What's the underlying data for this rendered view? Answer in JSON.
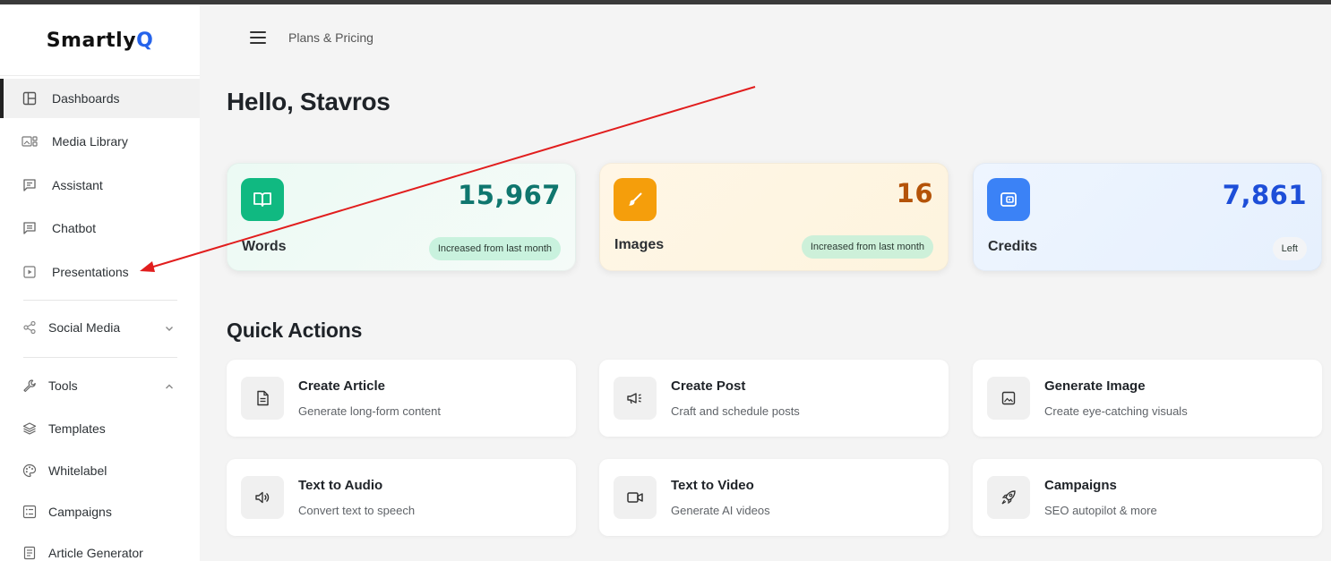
{
  "app": {
    "logo_prefix": "Smartly",
    "logo_suffix": "Q"
  },
  "header": {
    "breadcrumb": "Plans & Pricing"
  },
  "sidebar": {
    "items": [
      {
        "label": "Dashboards",
        "icon": "layout-icon"
      },
      {
        "label": "Media Library",
        "icon": "media-library-icon"
      },
      {
        "label": "Assistant",
        "icon": "chat-icon"
      },
      {
        "label": "Chatbot",
        "icon": "chatbot-icon"
      },
      {
        "label": "Presentations",
        "icon": "play-icon"
      },
      {
        "label": "Social Media",
        "icon": "share-icon"
      },
      {
        "label": "Tools",
        "icon": "wrench-icon"
      },
      {
        "label": "Templates",
        "icon": "layers-icon"
      },
      {
        "label": "Whitelabel",
        "icon": "palette-icon"
      },
      {
        "label": "Campaigns",
        "icon": "list-icon"
      },
      {
        "label": "Article Generator",
        "icon": "document-icon"
      }
    ]
  },
  "main": {
    "greeting": "Hello, Stavros",
    "stats": [
      {
        "name": "Words",
        "value": "15,967",
        "pill": "Increased from last month",
        "color": "#0f766e",
        "icon_bg": "#10b981"
      },
      {
        "name": "Images",
        "value": "16",
        "pill": "Increased from last month",
        "color": "#b45309",
        "icon_bg": "#f59e0b"
      },
      {
        "name": "Credits",
        "value": "7,861",
        "pill": "Left",
        "color": "#1d4ed8",
        "icon_bg": "#3b82f6"
      }
    ],
    "quick_actions_title": "Quick Actions",
    "actions": [
      {
        "title": "Create Article",
        "subtitle": "Generate long-form content"
      },
      {
        "title": "Create Post",
        "subtitle": "Craft and schedule posts"
      },
      {
        "title": "Generate Image",
        "subtitle": "Create eye-catching visuals"
      },
      {
        "title": "Text to Audio",
        "subtitle": "Convert text to speech"
      },
      {
        "title": "Text to Video",
        "subtitle": "Generate AI videos"
      },
      {
        "title": "Campaigns",
        "subtitle": "SEO autopilot & more"
      }
    ]
  }
}
